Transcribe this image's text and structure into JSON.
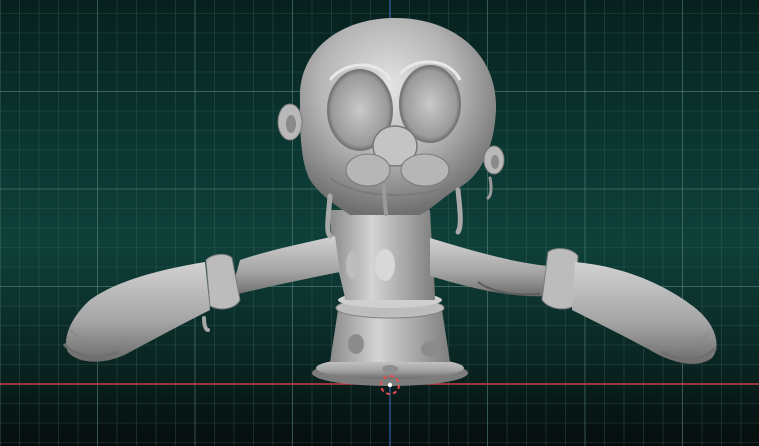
{
  "viewport": {
    "background_top": "#07201d",
    "background_mid": "#0f4039",
    "grid_minor_color": "#3f6a63",
    "grid_major_color": "#5e8c84",
    "axis_x_color": "#c8404a",
    "axis_y_color": "#3b6fd1",
    "cursor_color": "#e34d4d"
  },
  "model": {
    "icon": "sculpt-model-icon",
    "material_light": "#d6d6d6",
    "material_mid": "#a9a9a9",
    "material_dark": "#6a6a6a"
  },
  "cursor": {
    "icon": "3d-cursor-icon"
  }
}
